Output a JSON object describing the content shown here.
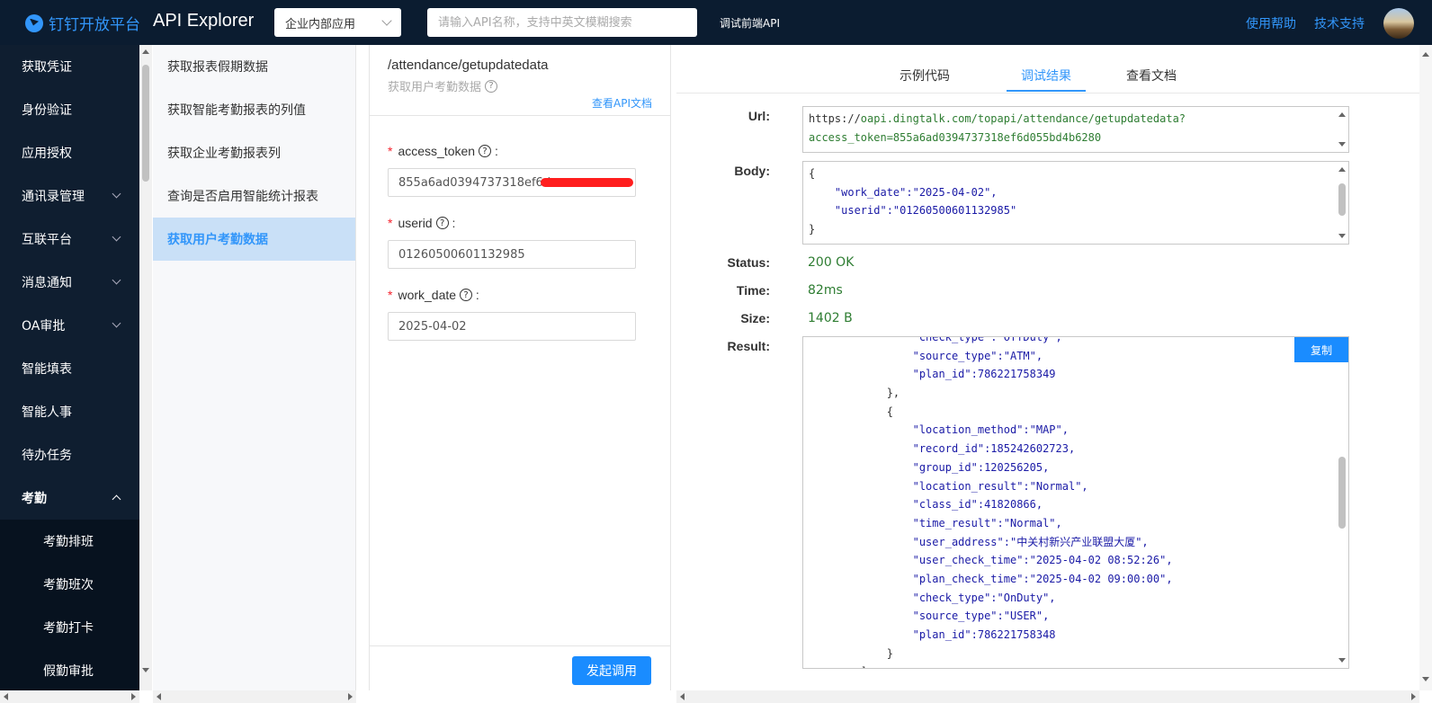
{
  "header": {
    "brand": "钉钉开放平台",
    "title": "API Explorer",
    "app_type": "企业内部应用",
    "search_placeholder": "请输入API名称，支持中英文模糊搜索",
    "frontend_api": "调试前端API",
    "help": "使用帮助",
    "support": "技术支持"
  },
  "nav": {
    "items": [
      {
        "label": "获取凭证",
        "expandable": false
      },
      {
        "label": "身份验证",
        "expandable": false
      },
      {
        "label": "应用授权",
        "expandable": false
      },
      {
        "label": "通讯录管理",
        "expandable": true
      },
      {
        "label": "互联平台",
        "expandable": true
      },
      {
        "label": "消息通知",
        "expandable": true
      },
      {
        "label": "OA审批",
        "expandable": true
      },
      {
        "label": "智能填表",
        "expandable": false
      },
      {
        "label": "智能人事",
        "expandable": false
      },
      {
        "label": "待办任务",
        "expandable": false
      },
      {
        "label": "考勤",
        "expandable": true,
        "open": true
      }
    ],
    "sub_items": [
      "考勤排班",
      "考勤班次",
      "考勤打卡",
      "假勤审批"
    ]
  },
  "api_list": {
    "items": [
      "获取报表假期数据",
      "获取智能考勤报表的列值",
      "获取企业考勤报表列",
      "查询是否启用智能统计报表",
      "获取用户考勤数据"
    ],
    "active": "获取用户考勤数据"
  },
  "params": {
    "path": "/attendance/getupdatedata",
    "description": "获取用户考勤数据",
    "doc_link": "查看API文档",
    "fields": [
      {
        "name": "access_token",
        "value": "855a6ad0394737318ef6d"
      },
      {
        "name": "userid",
        "value": "01260500601132985"
      },
      {
        "name": "work_date",
        "value": "2025-04-02"
      }
    ],
    "invoke": "发起调用"
  },
  "result_panel": {
    "tabs": [
      "示例代码",
      "调试结果",
      "查看文档"
    ],
    "active_tab": "调试结果",
    "url_label": "Url:",
    "url_prefix": "https://",
    "url_rest": "oapi.dingtalk.com/topapi/attendance/getupdatedata?",
    "url_line2": "access_token=855a6ad0394737318ef6d055bd4b6280",
    "body_label": "Body:",
    "body_lines": [
      "{",
      "    \"work_date\":\"2025-04-02\",",
      "    \"userid\":\"01260500601132985\"",
      "}"
    ],
    "status_label": "Status:",
    "status": "200 OK",
    "time_label": "Time:",
    "time": "82ms",
    "size_label": "Size:",
    "size": "1402 B",
    "result_label": "Result:",
    "copy": "复制",
    "result_lines": [
      "                \"check_type\":\"OffDuty\",",
      "                \"source_type\":\"ATM\",",
      "                \"plan_id\":786221758349",
      "            },",
      "            {",
      "                \"location_method\":\"MAP\",",
      "                \"record_id\":185242602723,",
      "                \"group_id\":120256205,",
      "                \"location_result\":\"Normal\",",
      "                \"class_id\":41820866,",
      "                \"time_result\":\"Normal\",",
      "                \"user_address\":\"中关村新兴产业联盟大厦\",",
      "                \"user_check_time\":\"2025-04-02 08:52:26\",",
      "                \"plan_check_time\":\"2025-04-02 09:00:00\",",
      "                \"check_type\":\"OnDuty\",",
      "                \"source_type\":\"USER\",",
      "                \"plan_id\":786221758348",
      "            }",
      "        ],"
    ]
  },
  "colors": {
    "accent": "#3296fa",
    "nav_bg": "#0f1e30",
    "topbar_bg": "#0b1c30",
    "ok": "#2e7d32"
  }
}
